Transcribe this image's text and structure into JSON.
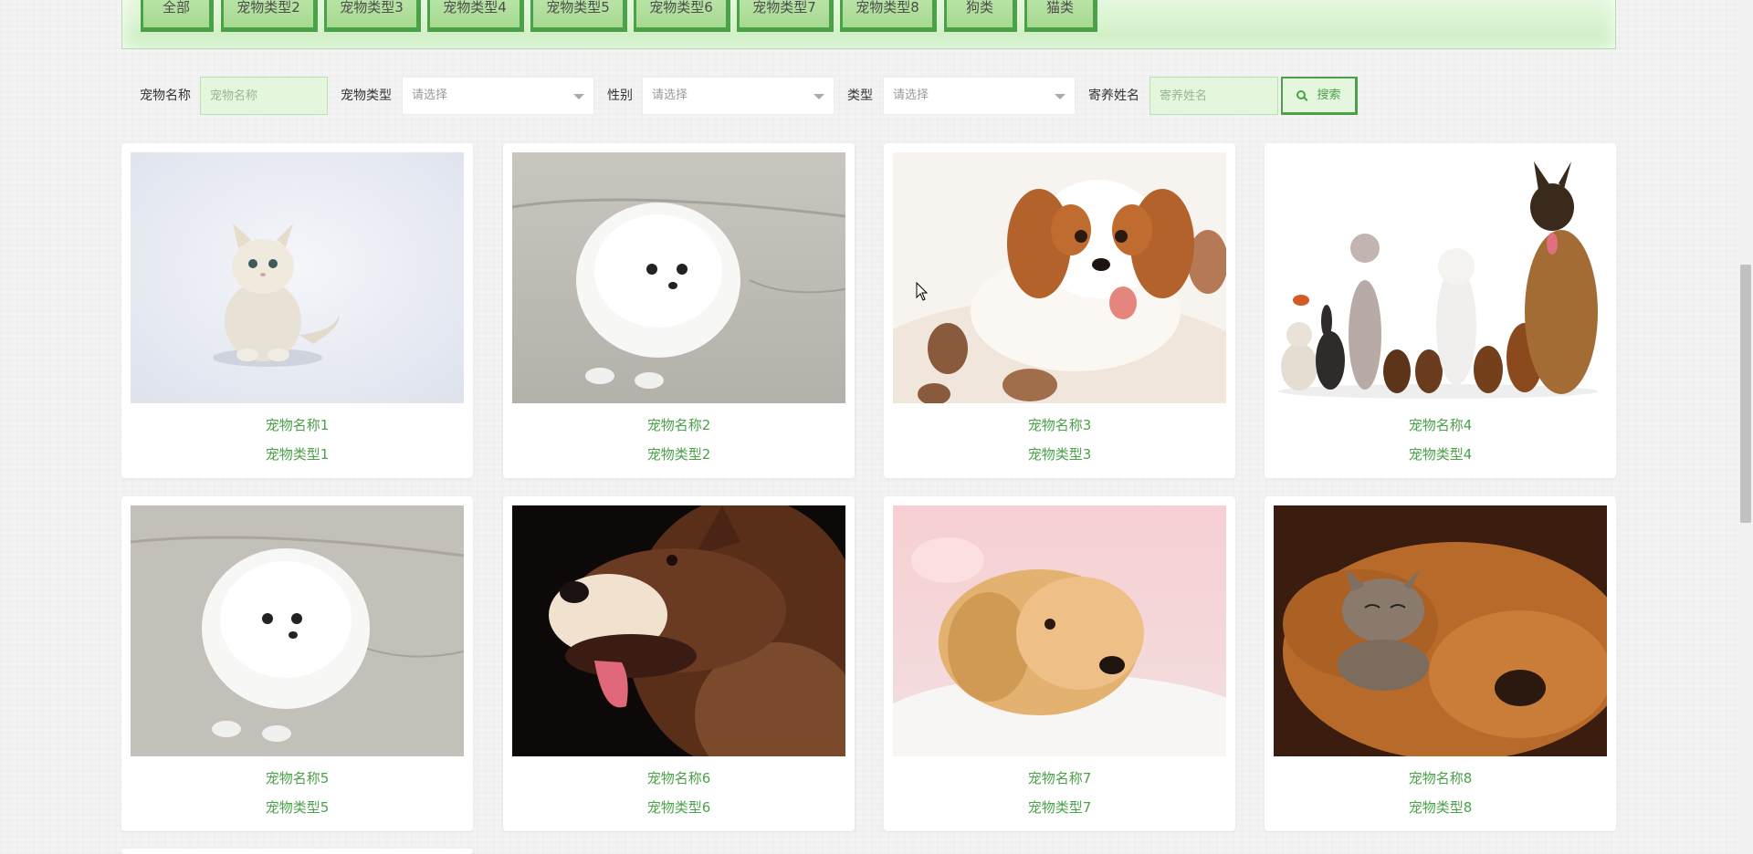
{
  "categories": [
    "全部",
    "宠物类型2",
    "宠物类型3",
    "宠物类型4",
    "宠物类型5",
    "宠物类型6",
    "宠物类型7",
    "宠物类型8",
    "狗类",
    "猫类"
  ],
  "search": {
    "pet_name_label": "宠物名称",
    "pet_name_placeholder": "宠物名称",
    "pet_type_label": "宠物类型",
    "pet_type_value": "请选择",
    "gender_label": "性别",
    "gender_value": "请选择",
    "kind_label": "类型",
    "kind_value": "请选择",
    "foster_name_label": "寄养姓名",
    "foster_name_placeholder": "寄养姓名",
    "button_label": "搜索"
  },
  "pets": [
    {
      "name": "宠物名称1",
      "type": "宠物类型1",
      "image": "white-persian-kitten"
    },
    {
      "name": "宠物名称2",
      "type": "宠物类型2",
      "image": "white-pomeranian-puppy"
    },
    {
      "name": "宠物名称3",
      "type": "宠物类型3",
      "image": "cavalier-spaniel-puppy"
    },
    {
      "name": "宠物名称4",
      "type": "宠物类型4",
      "image": "group-of-cats-and-dogs"
    },
    {
      "name": "宠物名称5",
      "type": "宠物类型5",
      "image": "white-pomeranian-puppy"
    },
    {
      "name": "宠物名称6",
      "type": "宠物类型6",
      "image": "alaskan-malamute-portrait"
    },
    {
      "name": "宠物名称7",
      "type": "宠物类型7",
      "image": "golden-retriever-puppy"
    },
    {
      "name": "宠物名称8",
      "type": "宠物类型8",
      "image": "bloodhound-with-kitten"
    }
  ],
  "colors": {
    "accent": "#4aa148",
    "strip_bg": "#d8f3cf",
    "input_bg": "#e4f6dd"
  }
}
